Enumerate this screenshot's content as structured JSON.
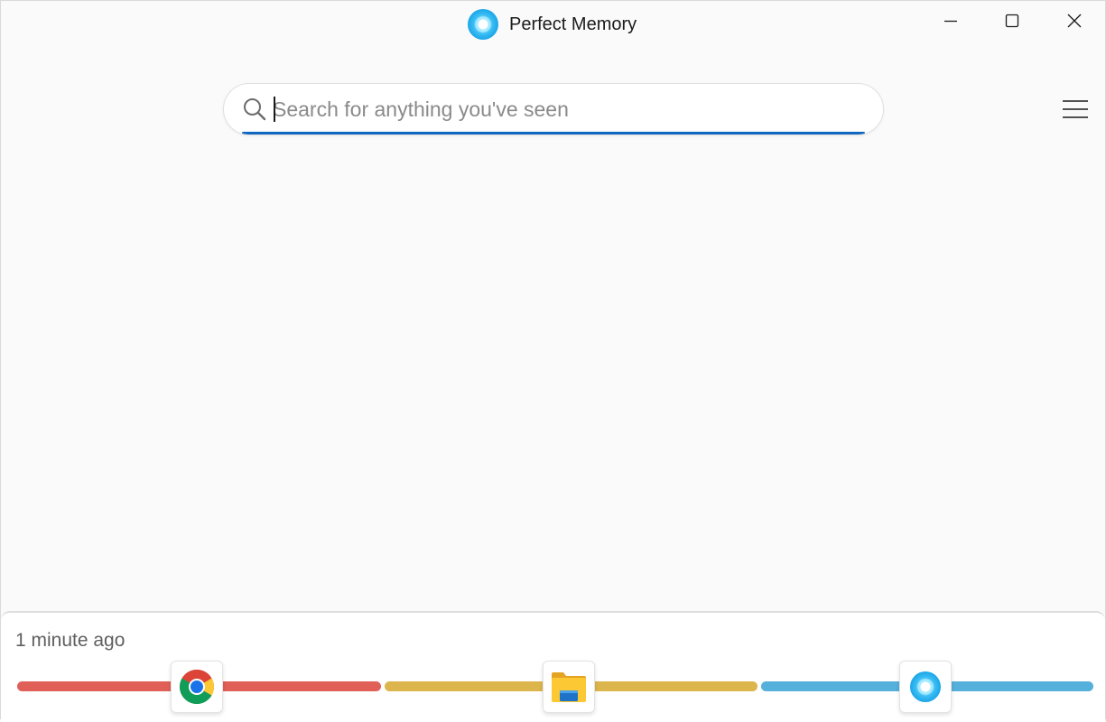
{
  "window": {
    "title": "Perfect Memory",
    "logo_icon": "perfect-memory-logo-icon",
    "controls": {
      "minimize_icon": "minimize-icon",
      "maximize_icon": "maximize-icon",
      "close_icon": "close-icon"
    }
  },
  "search": {
    "placeholder": "Search for anything you've seen",
    "value": "",
    "icon": "search-icon",
    "accent_color": "#0f67c0"
  },
  "menu": {
    "icon": "hamburger-menu-icon"
  },
  "timeline": {
    "time_label": "1 minute ago",
    "segments": [
      {
        "app": "chrome",
        "icon": "chrome-icon",
        "color": "#e06057"
      },
      {
        "app": "file-explorer",
        "icon": "file-explorer-icon",
        "color": "#dcb54c"
      },
      {
        "app": "perfect-memory",
        "icon": "perfect-memory-logo-icon",
        "color": "#55b0db"
      }
    ]
  }
}
